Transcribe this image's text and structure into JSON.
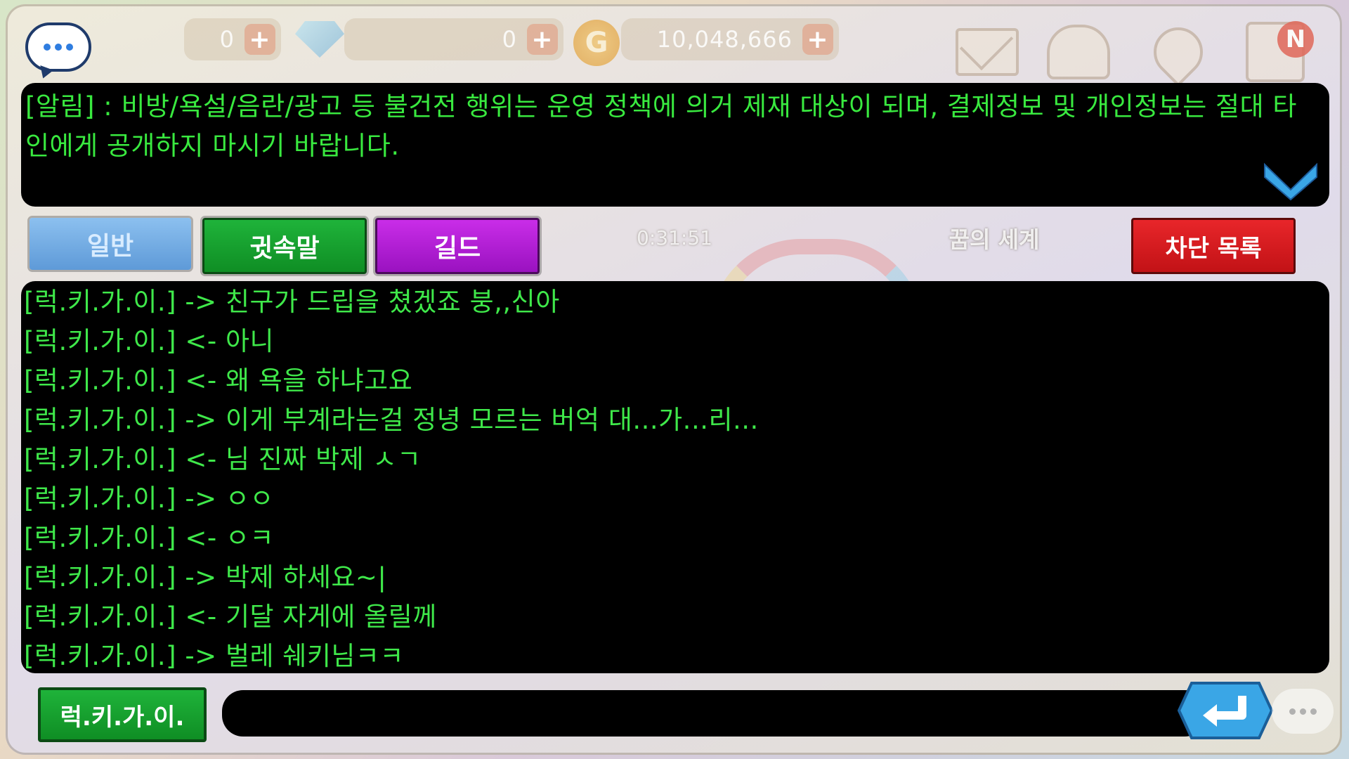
{
  "currencies": {
    "first_amount": "0",
    "gem_amount": "0",
    "gold_amount": "10,048,666",
    "coin_glyph": "G",
    "plus_glyph": "+"
  },
  "badges": {
    "new_glyph": "N"
  },
  "notice": {
    "text": "[알림] : 비방/욕설/음란/광고 등 불건전 행위는 운영 정책에 의거 제재 대상이 되며, 결제정보 및 개인정보는 절대 타인에게 공개하지 마시기 바랍니다."
  },
  "tabs": {
    "general": "일반",
    "whisper": "귓속말",
    "guild": "길드"
  },
  "timer": "0:31:51",
  "world_name": "꿈의 세계",
  "block_list_label": "차단 목록",
  "chat_lines": [
    "[럭.키.가.이.] -> 친구가 드립을 쳤겠죠 붕,,신아",
    "[럭.키.가.이.] <- 아니",
    "[럭.키.가.이.] <- 왜 욕을 하냐고요",
    "[럭.키.가.이.] -> 이게 부계라는걸 정녕 모르는 버억 대...가...리...",
    "[럭.키.가.이.] <- 님 진짜 박제 ㅅㄱ",
    "[럭.키.가.이.] -> ㅇㅇ",
    "[럭.키.가.이.] <- ㅇㅋ",
    "[럭.키.가.이.] -> 박제 하세요~|",
    "[럭.키.가.이.] <- 기달 자게에 올릴께",
    "[럭.키.가.이.] -> 벌레 쉐키님ㅋㅋ"
  ],
  "input": {
    "sender_name": "럭.키.가.이.",
    "value": ""
  },
  "colors": {
    "chat_green": "#3fe84a",
    "whisper_tab": "#15a030",
    "guild_tab": "#b21fd6",
    "block_button": "#d41c20",
    "send_button": "#3aa6e6"
  }
}
